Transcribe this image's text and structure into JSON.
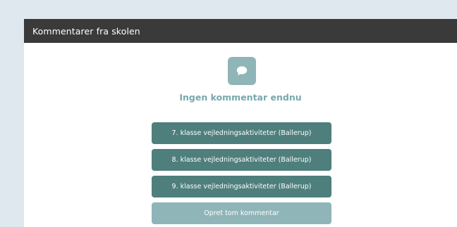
{
  "header": {
    "title": "Kommentarer fra skolen"
  },
  "empty_state": {
    "icon": "speech-bubble-icon",
    "message": "Ingen kommentar endnu"
  },
  "actions": [
    {
      "label": "7. klasse vejledningsaktiviteter (Ballerup)"
    },
    {
      "label": "8. klasse vejledningsaktiviteter (Ballerup)"
    },
    {
      "label": "9. klasse vejledningsaktiviteter (Ballerup)"
    },
    {
      "label": "Opret tom kommentar"
    }
  ],
  "colors": {
    "background": "#dfe8ee",
    "header": "#3a3a3a",
    "primary_button": "#4e7f7c",
    "secondary_button": "#8fb5b8",
    "accent_text": "#78a8ab"
  }
}
